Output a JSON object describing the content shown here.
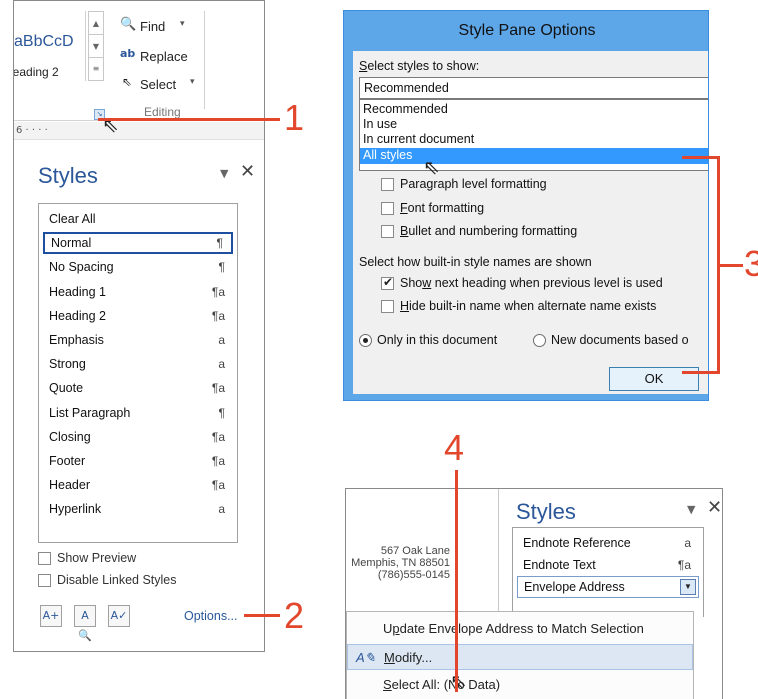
{
  "ribbon": {
    "style_preview": "aBbCcD",
    "heading2": "leading 2",
    "find": "Find",
    "replace": "Replace",
    "select": "Select",
    "editing": "Editing",
    "ruler": "6"
  },
  "styles_pane": {
    "title": "Styles",
    "items": [
      {
        "label": "Clear All",
        "sym": ""
      },
      {
        "label": "Normal",
        "sym": "¶"
      },
      {
        "label": "No Spacing",
        "sym": "¶"
      },
      {
        "label": "Heading 1",
        "sym": "¶a"
      },
      {
        "label": "Heading 2",
        "sym": "¶a"
      },
      {
        "label": "Emphasis",
        "sym": "a"
      },
      {
        "label": "Strong",
        "sym": "a"
      },
      {
        "label": "Quote",
        "sym": "¶a"
      },
      {
        "label": "List Paragraph",
        "sym": "¶"
      },
      {
        "label": "Closing",
        "sym": "¶a"
      },
      {
        "label": "Footer",
        "sym": "¶a"
      },
      {
        "label": "Header",
        "sym": "¶a"
      },
      {
        "label": "Hyperlink",
        "sym": "a"
      }
    ],
    "show_preview": "Show Preview",
    "disable_linked": "Disable Linked Styles",
    "options": "Options..."
  },
  "dialog": {
    "title": "Style Pane Options",
    "select_label_pre": "",
    "select_label_u": "S",
    "select_label_post": "elect styles to show:",
    "select_value": "Recommended",
    "options": [
      "Recommended",
      "In use",
      "In current document",
      "All styles"
    ],
    "paragraph_fmt": "Paragraph level formatting",
    "font_fmt_u": "F",
    "font_fmt_post": "ont formatting",
    "bullet_fmt_u": "B",
    "bullet_fmt_post": "ullet and numbering formatting",
    "builtin_label": "Select how built-in style names are shown",
    "show_next_pre": "Sho",
    "show_next_u": "w",
    "show_next_post": " next heading when previous level is used",
    "hide_builtin_u": "H",
    "hide_builtin_post": "ide built-in name when alternate name exists",
    "only_doc": "Only in this document",
    "new_docs": "New documents based o",
    "ok": "OK"
  },
  "panel3": {
    "title": "Styles",
    "address": [
      "567 Oak Lane",
      "Memphis, TN 88501",
      "(786)555-0145"
    ],
    "items": [
      {
        "label": "Endnote Reference",
        "sym": "a"
      },
      {
        "label": "Endnote Text",
        "sym": "¶a"
      },
      {
        "label": "Envelope Address",
        "sym": ""
      }
    ],
    "menu": {
      "update_pre": "U",
      "update_u": "p",
      "update_post": "date Envelope Address to Match Selection",
      "modify_u": "M",
      "modify_post": "odify...",
      "select_all_u": "S",
      "select_all_post": "elect All: (No Data)"
    }
  },
  "callouts": [
    "1",
    "2",
    "3",
    "4"
  ],
  "colors": {
    "accent": "#e2462c",
    "dialog_frame": "#5da6e8",
    "selection": "#3399ff",
    "title_blue": "#2b579a"
  }
}
